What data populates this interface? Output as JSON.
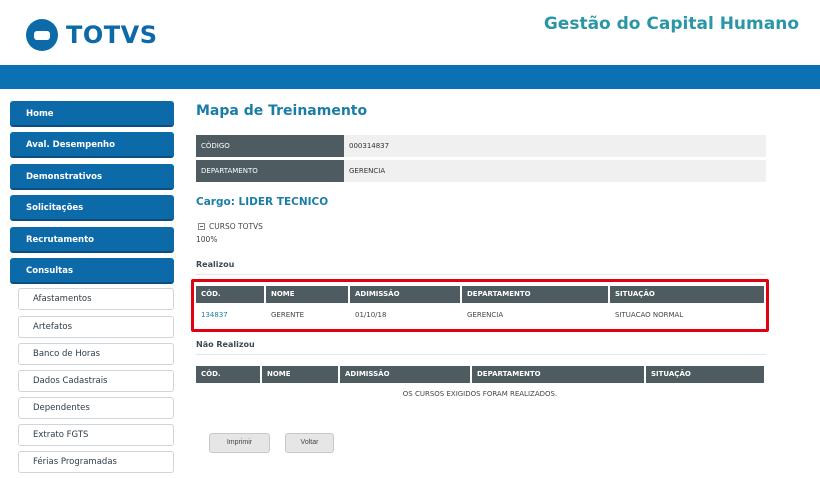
{
  "header": {
    "logo_text": "TOTVS",
    "app_title": "Gestão do Capital Humano"
  },
  "sidebar": {
    "items": [
      {
        "label": "Home"
      },
      {
        "label": "Aval. Desempenho"
      },
      {
        "label": "Demonstrativos"
      },
      {
        "label": "Solicitações"
      },
      {
        "label": "Recrutamento"
      },
      {
        "label": "Consultas"
      }
    ],
    "subitems": [
      {
        "label": "Afastamentos"
      },
      {
        "label": "Artefatos"
      },
      {
        "label": "Banco de Horas"
      },
      {
        "label": "Dados Cadastrais"
      },
      {
        "label": "Dependentes"
      },
      {
        "label": "Extrato FGTS"
      },
      {
        "label": "Férias Programadas"
      }
    ]
  },
  "main": {
    "title": "Mapa de Treinamento",
    "info": [
      {
        "label": "CÓDIGO",
        "value": "000314837"
      },
      {
        "label": "DEPARTAMENTO",
        "value": "GERENCIA"
      }
    ],
    "cargo": "Cargo: LIDER TECNICO",
    "course": "CURSO TOTVS",
    "percent": "100%",
    "realizou": {
      "title": "Realizou",
      "columns": [
        "CÓD.",
        "NOME",
        "ADIMISSÃO",
        "DEPARTAMENTO",
        "SITUAÇÃO"
      ],
      "rows": [
        {
          "cod": "134837",
          "nome": "GERENTE",
          "admissao": "01/10/18",
          "departamento": "GERENCIA",
          "situacao": "SITUACAO NORMAL"
        }
      ]
    },
    "nao_realizou": {
      "title": "Não Realizou",
      "columns": [
        "CÓD.",
        "NOME",
        "ADIMISSÃO",
        "DEPARTAMENTO",
        "SITUAÇÃO"
      ],
      "empty_message": "OS CURSOS EXIGIDOS FORAM REALIZADOS."
    },
    "buttons": {
      "print": "Imprimir",
      "back": "Voltar"
    }
  },
  "colors": {
    "brand_blue": "#0d6aa8",
    "title_teal": "#1b7da7",
    "header_gray": "#4e5b61",
    "highlight_red": "#e00010"
  }
}
